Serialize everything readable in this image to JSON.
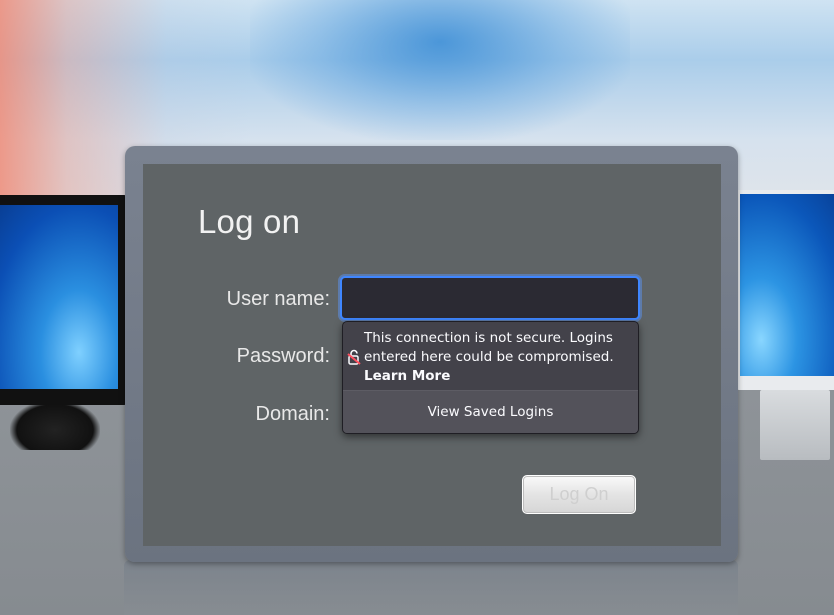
{
  "login": {
    "title": "Log on",
    "username_label": "User name:",
    "username_value": "",
    "password_label": "Password:",
    "domain_label": "Domain:",
    "logon_button": "Log On"
  },
  "insecure_popup": {
    "icon": "insecure-lock-icon",
    "warning": "This connection is not secure. Logins entered here could be compromised.",
    "learn_more": "Learn More",
    "view_saved_logins": "View Saved Logins"
  },
  "colors": {
    "focus_ring": "#3f86ff",
    "popup_bg": "#43424a",
    "panel_bg": "#5f6466"
  }
}
